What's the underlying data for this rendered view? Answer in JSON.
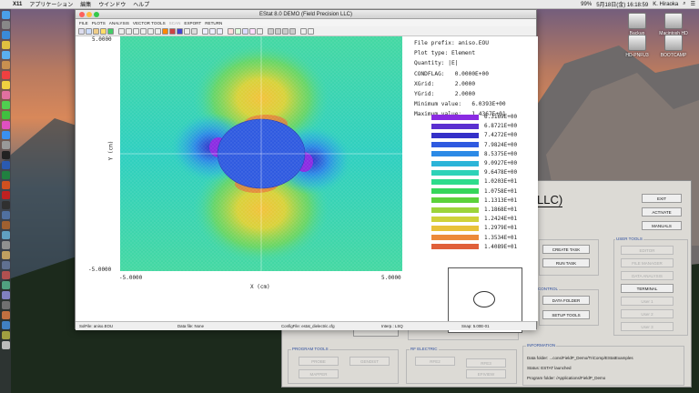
{
  "menubar": {
    "app": "X11",
    "items": [
      "アプリケーション",
      "編集",
      "ウインドウ",
      "ヘルプ"
    ],
    "battery": "99%",
    "datetime": "5月18日(金)  16:18:59",
    "user": "K. Hiraoka"
  },
  "desktop": {
    "icons": [
      "Backup",
      "Macintosh HD",
      "HD-PNFU3",
      "BOOTCAMP"
    ]
  },
  "estat": {
    "title": "EStat 8.0 DEMO (Field Precision LLC)",
    "menu": [
      "FILE",
      "PLOTS",
      "ANALYSIS",
      "VECTOR TOOLS",
      "SCAN",
      "EXPORT",
      "RETURN"
    ],
    "plot": {
      "y_top": "5.0000",
      "y_bottom": "-5.0000",
      "x_left": "-5.0000",
      "x_right": "5.0000",
      "x_axis_title": "X (cm)",
      "y_axis_title": "Y (cm)"
    },
    "meta": {
      "file_prefix": "File prefix: aniso.EOU",
      "plot_type": "Plot type: Element",
      "quantity": "Quantity: |E|",
      "condflag": "CONDFLAG:   0.0000E+00",
      "xgrid": "XGrid:      2.0000",
      "ygrid": "YGrid:      2.0000",
      "min": "Minimum value:   6.0393E+00",
      "max": "Maximum value:   1.4367E+01"
    },
    "legend": [
      {
        "label": "6.3169E+00",
        "color": "#8a2be2"
      },
      {
        "label": "6.8721E+00",
        "color": "#5a2fd0"
      },
      {
        "label": "7.4272E+00",
        "color": "#3430c8"
      },
      {
        "label": "7.9824E+00",
        "color": "#2f5ae0"
      },
      {
        "label": "8.5375E+00",
        "color": "#2c8ae6"
      },
      {
        "label": "9.0927E+00",
        "color": "#2cb4d8"
      },
      {
        "label": "9.6478E+00",
        "color": "#2ed2b8"
      },
      {
        "label": "1.0203E+01",
        "color": "#2edc8c"
      },
      {
        "label": "1.0758E+01",
        "color": "#36d65a"
      },
      {
        "label": "1.1313E+01",
        "color": "#5cd23a"
      },
      {
        "label": "1.1868E+01",
        "color": "#9cd43a"
      },
      {
        "label": "1.2424E+01",
        "color": "#cfd23a"
      },
      {
        "label": "1.2979E+01",
        "color": "#e8c23a"
      },
      {
        "label": "1.3534E+01",
        "color": "#ec8a3a"
      },
      {
        "label": "1.4089E+01",
        "color": "#e0603a"
      }
    ],
    "status": {
      "solfile": "SolFile: aniso.EOU",
      "datafile": "Data file: None",
      "configfile": "ConfigFile: estat_dielectric.cfg",
      "interp": "Interp.: LSQ",
      "snap": "Snap: 5.00E-01"
    }
  },
  "control": {
    "title_fragment": "LLC)",
    "buttons_main": {
      "exit": "EXIT",
      "activate": "ACTIVATE",
      "manuals": "MANUALS"
    },
    "user_tools": {
      "label": "USER TOOLS",
      "items": [
        "EDITOR",
        "FILE MANAGER",
        "DATA ANALYSIS",
        "TERMINAL",
        "User 1",
        "User 2",
        "User 3"
      ]
    },
    "task": {
      "create": "CREATE TASK",
      "run": "RUN TASK"
    },
    "control": {
      "label": "CONTROL",
      "data_folder": "DATA FOLDER",
      "setup_tools": "SETUP TOOLS"
    },
    "program_tools": {
      "label": "PROGRAM TOOLS",
      "items": [
        "PROBE",
        "GENDIST",
        "MAPPER"
      ]
    },
    "rf_electric": {
      "label": "RF ELECTRIC",
      "items": [
        "RFE2",
        "RFE3",
        "EFIVIEW"
      ]
    },
    "information": {
      "label": "INFORMATION",
      "data_folder": "Data folder: ...cons/FieldP_Demo/TriComp/EStatExamples",
      "status": "Status: ESTAT launched",
      "program_folder": "Program folder: /Applications/FieldP_Demo"
    }
  }
}
